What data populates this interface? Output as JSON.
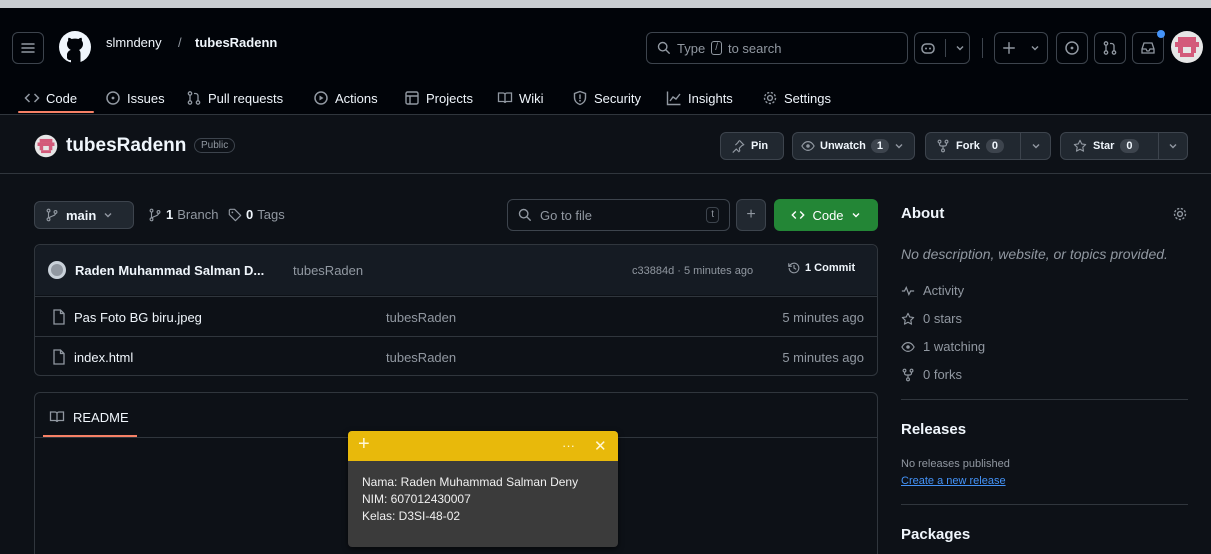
{
  "header": {
    "owner": "slmndeny",
    "separator": "/",
    "repo": "tubesRadenn",
    "search": {
      "prefix": "Type",
      "key": "/",
      "suffix": "to search"
    }
  },
  "nav": {
    "tabs": [
      {
        "label": "Code"
      },
      {
        "label": "Issues"
      },
      {
        "label": "Pull requests"
      },
      {
        "label": "Actions"
      },
      {
        "label": "Projects"
      },
      {
        "label": "Wiki"
      },
      {
        "label": "Security"
      },
      {
        "label": "Insights"
      },
      {
        "label": "Settings"
      }
    ]
  },
  "repo": {
    "name": "tubesRadenn",
    "visibility": "Public",
    "pin_label": "Pin",
    "unwatch_label": "Unwatch",
    "unwatch_count": "1",
    "fork_label": "Fork",
    "fork_count": "0",
    "star_label": "Star",
    "star_count": "0"
  },
  "toolbar": {
    "branch": "main",
    "branches_count": "1",
    "branches_label": "Branch",
    "tags_count": "0",
    "tags_label": "Tags",
    "goto_placeholder": "Go to file",
    "goto_key": "t",
    "add_label": "+",
    "code_label": "Code"
  },
  "commit": {
    "author": "Raden Muhammad Salman D...",
    "message": "tubesRaden",
    "hash_time": "c33884d · 5 minutes ago",
    "count_label": "1 Commit"
  },
  "files": [
    {
      "name": "Pas Foto BG biru.jpeg",
      "message": "tubesRaden",
      "time": "5 minutes ago"
    },
    {
      "name": "index.html",
      "message": "tubesRaden",
      "time": "5 minutes ago"
    }
  ],
  "readme": {
    "label": "README"
  },
  "about": {
    "title": "About",
    "description": "No description, website, or topics provided.",
    "activity": "Activity",
    "stars": "0 stars",
    "watching": "1 watching",
    "forks": "0 forks"
  },
  "releases": {
    "title": "Releases",
    "none": "No releases published",
    "create_link": "Create a new release"
  },
  "packages": {
    "title": "Packages"
  },
  "sticky_note": {
    "add": "+",
    "more": "···",
    "close": "✕",
    "lines": [
      "Nama: Raden Muhammad Salman Deny",
      "NIM: 607012430007",
      "Kelas: D3SI-48-02"
    ]
  },
  "colors": {
    "accent_orange": "#f78166",
    "code_green": "#238636",
    "link_blue": "#4493f8",
    "sticky_yellow": "#e8b90b"
  }
}
